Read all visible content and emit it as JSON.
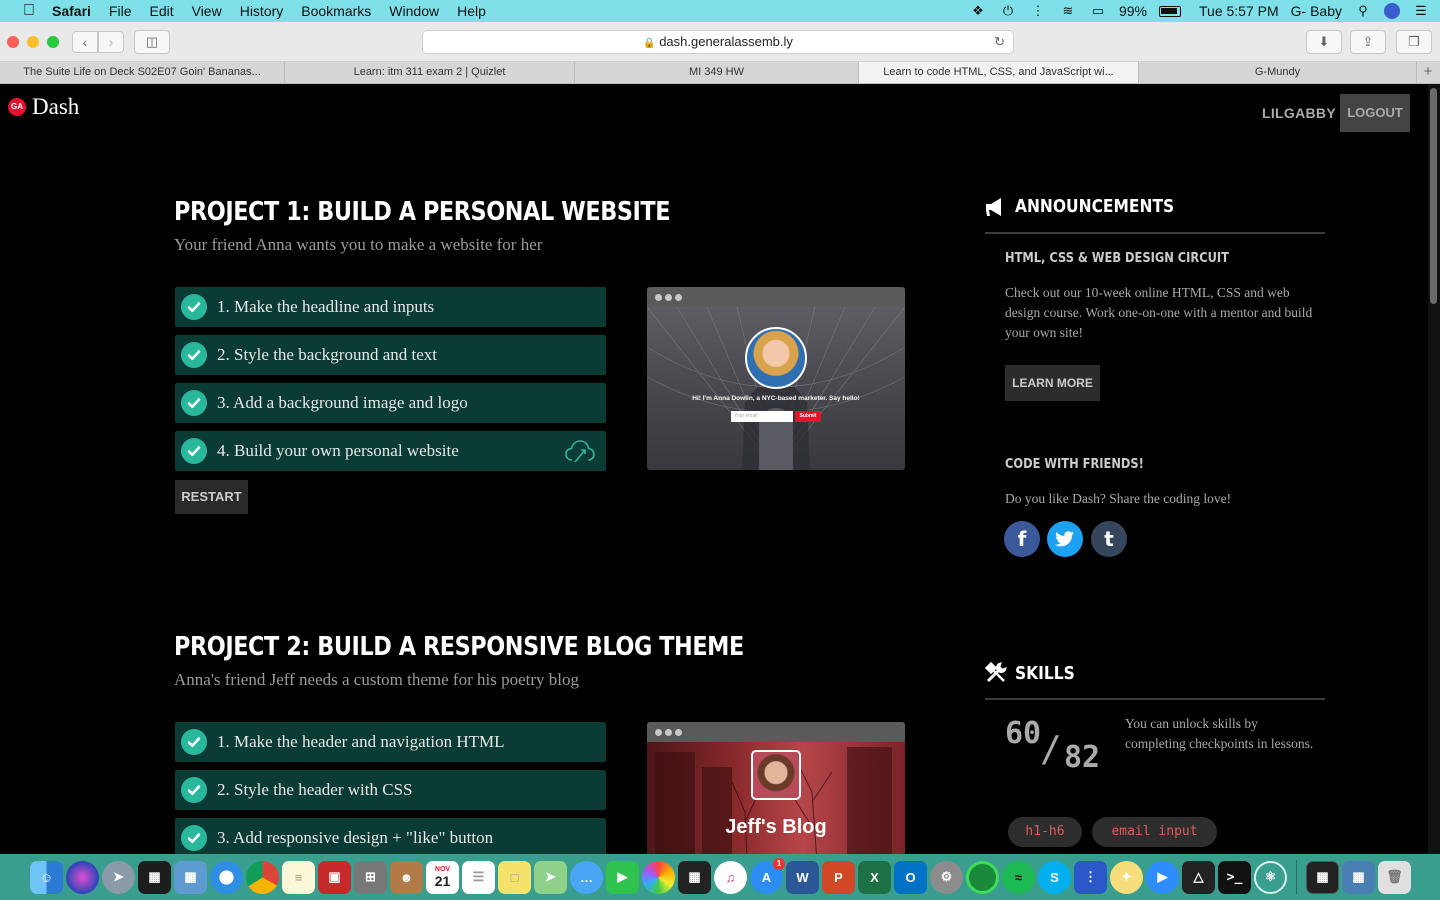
{
  "menubar": {
    "app": "Safari",
    "items": [
      "File",
      "Edit",
      "View",
      "History",
      "Bookmarks",
      "Window",
      "Help"
    ],
    "battery": "99%",
    "time": "Tue 5:57 PM",
    "user": "G- Baby"
  },
  "browser": {
    "url": "dash.generalassemb.ly",
    "tabs": [
      "The Suite Life on Deck S02E07 Goin' Bananas...",
      "Learn: itm 311 exam 2 | Quizlet",
      "MI 349 HW",
      "Learn to code HTML, CSS, and JavaScript wi...",
      "G-Mundy"
    ],
    "active_tab": 3
  },
  "site": {
    "logo_badge": "GA",
    "logo_text": "Dash",
    "username": "LILGABBY",
    "logout": "LOGOUT"
  },
  "projects": [
    {
      "title": "PROJECT 1: BUILD A PERSONAL WEBSITE",
      "subtitle": "Your friend Anna wants you to make a website for her",
      "steps": [
        "1. Make the headline and inputs",
        "2. Style the background and text",
        "3. Add a background image and logo",
        "4. Build your own personal website"
      ],
      "restart": "RESTART",
      "preview": {
        "headline": "Hi! I'm Anna Dowlin, a NYC-based marketer. Say hello!",
        "input_placeholder": "Your email",
        "submit": "Submit"
      }
    },
    {
      "title": "PROJECT 2: BUILD A RESPONSIVE BLOG THEME",
      "subtitle": "Anna's friend Jeff needs a custom theme for his poetry blog",
      "steps": [
        "1. Make the header and navigation HTML",
        "2. Style the header with CSS",
        "3. Add responsive design + \"like\" button"
      ],
      "preview": {
        "headline": "Jeff's Blog"
      }
    }
  ],
  "sidebar": {
    "announcements": {
      "title": "ANNOUNCEMENTS",
      "circuit_heading": "HTML, CSS & WEB DESIGN CIRCUIT",
      "circuit_text": "Check out our 10-week online HTML, CSS and web design course. Work one-on-one with a mentor and build your own site!",
      "learn_more": "LEARN MORE",
      "friends_heading": "CODE WITH FRIENDS!",
      "friends_text": "Do you like Dash? Share the coding love!"
    },
    "skills": {
      "title": "SKILLS",
      "unlocked": "60",
      "separator": "/",
      "total": "82",
      "description": "You can unlock skills by completing checkpoints in lessons.",
      "tags": [
        "h1-h6",
        "email input"
      ]
    }
  },
  "dock": {
    "calendar_month": "NOV",
    "calendar_day": "21",
    "appstore_badge": "1"
  },
  "colors": {
    "menubar": "#7ee0e8",
    "step_bg": "#0b3b35",
    "check": "#2ab89d",
    "ga_red": "#e8112d",
    "tag_text": "#e25b5b",
    "facebook": "#3b5998",
    "twitter": "#1da1f2",
    "tumblr": "#35465c"
  }
}
